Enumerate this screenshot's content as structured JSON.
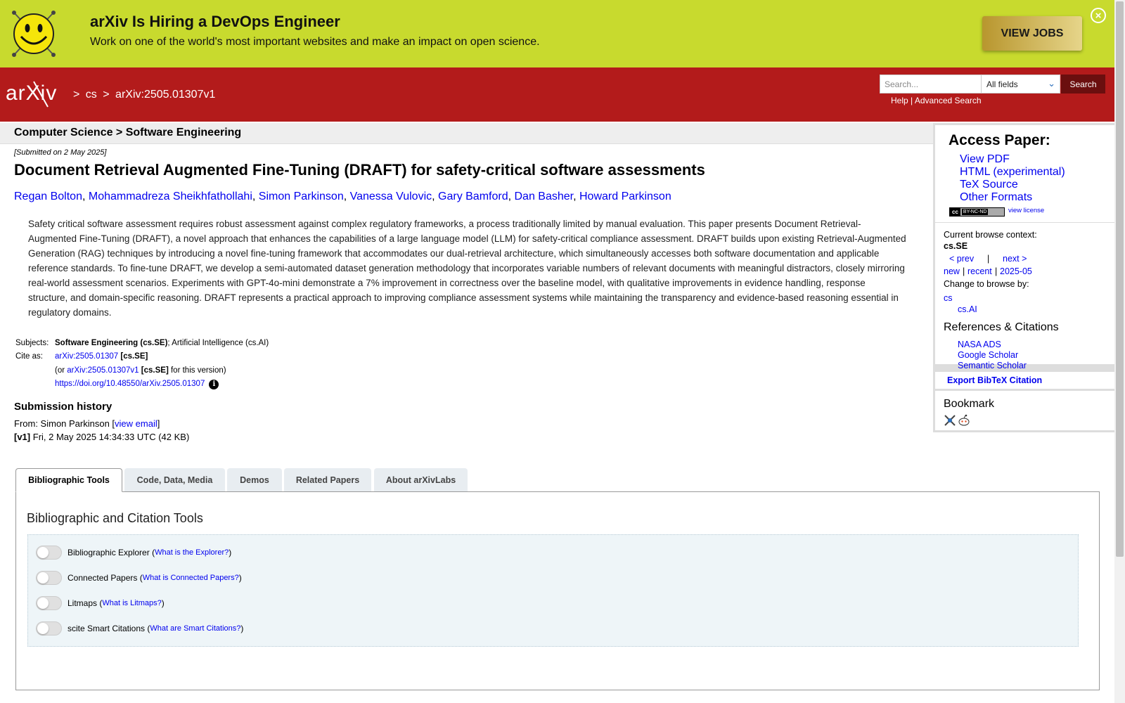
{
  "banner": {
    "title": "arXiv Is Hiring a DevOps Engineer",
    "subtitle": "Work on one of the world's most important websites and make an impact on open science.",
    "cta": "VIEW JOBS",
    "close_icon": "close-circle-icon"
  },
  "header": {
    "logo": "arXiv",
    "breadcrumb": [
      ">",
      "cs",
      ">",
      "arXiv:2505.01307v1"
    ],
    "search_placeholder": "Search...",
    "search_field": "All fields",
    "search_button": "Search",
    "help": "Help",
    "separator": "|",
    "advanced": "Advanced Search",
    "colors": {
      "header_bg": "#b31b1b",
      "banner_bg": "#c8da2e"
    }
  },
  "paper": {
    "subject_bar": "Computer Science > Software Engineering",
    "submitted": "[Submitted on 2 May 2025]",
    "title": "Document Retrieval Augmented Fine-Tuning (DRAFT) for safety-critical software assessments",
    "authors": [
      "Regan Bolton",
      "Mohammadreza Sheikhfathollahi",
      "Simon Parkinson",
      "Vanessa Vulovic",
      "Gary Bamford",
      "Dan Basher",
      "Howard Parkinson"
    ],
    "abstract": "Safety critical software assessment requires robust assessment against complex regulatory frameworks, a process traditionally limited by manual evaluation. This paper presents Document Retrieval-Augmented Fine-Tuning (DRAFT), a novel approach that enhances the capabilities of a large language model (LLM) for safety-critical compliance assessment. DRAFT builds upon existing Retrieval-Augmented Generation (RAG) techniques by introducing a novel fine-tuning framework that accommodates our dual-retrieval architecture, which simultaneously accesses both software documentation and applicable reference standards. To fine-tune DRAFT, we develop a semi-automated dataset generation methodology that incorporates variable numbers of relevant documents with meaningful distractors, closely mirroring real-world assessment scenarios. Experiments with GPT-4o-mini demonstrate a 7% improvement in correctness over the baseline model, with qualitative improvements in evidence handling, response structure, and domain-specific reasoning. DRAFT represents a practical approach to improving compliance assessment systems while maintaining the transparency and evidence-based reasoning essential in regulatory domains.",
    "subjects_label": "Subjects:",
    "subjects_primary": "Software Engineering (cs.SE)",
    "subjects_rest": "; Artificial Intelligence (cs.AI)",
    "cite_label": "Cite as:",
    "cite_id": "arXiv:2505.01307",
    "cite_tag": "[cs.SE]",
    "cite_or": "(or",
    "cite_version": "arXiv:2505.01307v1",
    "cite_version_tag": "[cs.SE]",
    "cite_version_suffix": "for this version)",
    "doi": "https://doi.org/10.48550/arXiv.2505.01307",
    "info_icon": "info-icon"
  },
  "history": {
    "title": "Submission history",
    "from_prefix": "From: Simon Parkinson [",
    "view_email": "view email",
    "from_suffix": "]",
    "v1_tag": "[v1]",
    "v1_text": "Fri, 2 May 2025 14:34:33 UTC (42 KB)"
  },
  "tabs": [
    {
      "label": "Bibliographic Tools",
      "active": true
    },
    {
      "label": "Code, Data, Media",
      "active": false
    },
    {
      "label": "Demos",
      "active": false
    },
    {
      "label": "Related Papers",
      "active": false
    },
    {
      "label": "About arXivLabs",
      "active": false
    }
  ],
  "tools": {
    "title": "Bibliographic and Citation Tools",
    "items": [
      {
        "name": "Bibliographic Explorer",
        "link": "What is the Explorer?"
      },
      {
        "name": "Connected Papers",
        "link": "What is Connected Papers?"
      },
      {
        "name": "Litmaps",
        "link": "What is Litmaps?"
      },
      {
        "name": "scite Smart Citations",
        "link": "What are Smart Citations?"
      }
    ]
  },
  "sidebar": {
    "access_title": "Access Paper:",
    "access_links": [
      "View PDF",
      "HTML (experimental)",
      "TeX Source",
      "Other Formats"
    ],
    "license_badge": "BY-NC-ND",
    "view_license": "view license",
    "context_label": "Current browse context:",
    "context_value": "cs.SE",
    "prev": "< prev",
    "pipe": "|",
    "next": "next >",
    "new": "new",
    "recent": "recent",
    "month": "2025-05",
    "change_label": "Change to browse by:",
    "browse_cs": "cs",
    "browse_csai": "cs.AI",
    "refs_title": "References & Citations",
    "refs_links": [
      "NASA ADS",
      "Google Scholar",
      "Semantic Scholar"
    ],
    "export": "Export BibTeX Citation",
    "bookmark_title": "Bookmark",
    "bookmark_icons": [
      "bibsonomy-icon",
      "reddit-icon"
    ]
  }
}
